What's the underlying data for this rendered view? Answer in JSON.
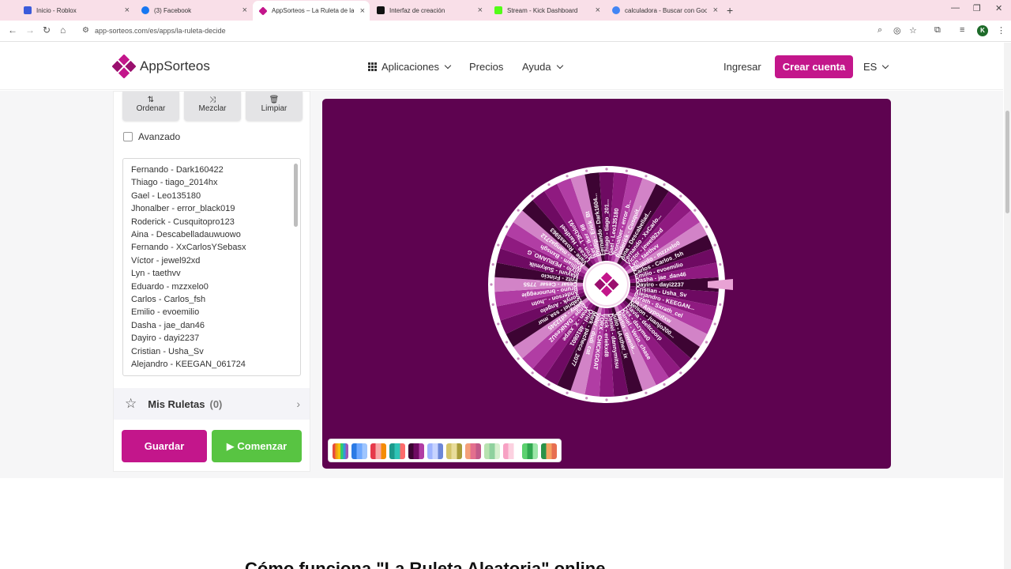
{
  "browser": {
    "tabs": [
      {
        "title": "Inicio - Roblox",
        "favicon_color": "#3b5bdb"
      },
      {
        "title": "(3) Facebook",
        "favicon_color": "#1877f2"
      },
      {
        "title": "AppSorteos – La Ruleta de la Su",
        "favicon_color": "#c3168b"
      },
      {
        "title": "Interfaz de creación",
        "favicon_color": "#111111"
      },
      {
        "title": "Stream - Kick Dashboard",
        "favicon_color": "#53fc18"
      },
      {
        "title": "calculadora - Buscar con Googl",
        "favicon_color": "#4285f4"
      }
    ],
    "url": "app-sorteos.com/es/apps/la-ruleta-decide",
    "profile_initial": "K"
  },
  "header": {
    "logo_text": "AppSorteos",
    "nav": [
      "Aplicaciones",
      "Precios",
      "Ayuda"
    ],
    "login": "Ingresar",
    "signup": "Crear cuenta",
    "language": "ES",
    "brand_color": "#c3168b"
  },
  "panel": {
    "tools": [
      "Ordenar",
      "Mezclar",
      "Limpiar"
    ],
    "advanced_label": "Avanzado",
    "names": [
      "Fernando - Dark160422",
      "Thiago - tiago_2014hx",
      "Gael - Leo135180",
      "Jhonalber - error_black019",
      "Roderick - Cusquitopro123",
      "Aina - Descabelladauwuowo",
      "Fernando - XxCarlosYSebasx",
      "Víctor - jewel92xd",
      "Lyn - taethvv",
      "Eduardo - mzzxelo0",
      "Carlos - Carlos_fsh",
      "Emilio - evoemilio",
      "Dasha - jae_dan46",
      "Dayiro  - dayi2237",
      "Cristian - Usha_Sv",
      "Alejandro - KEEGAN_061724"
    ],
    "mis_ruletas_label": "Mis Ruletas",
    "mis_ruletas_count": "(0)",
    "save_label": "Guardar",
    "start_label": "Comenzar"
  },
  "wheel": {
    "background": "#5e0350",
    "segment_colors": [
      "#3d0433",
      "#6e0a62",
      "#8f1a80",
      "#b13da4",
      "#d283c7"
    ],
    "labels": [
      "Dayiro - dayi2237",
      "Cristian - Usha_Sv",
      "Alejandro - KEEGAN...",
      "Sxrath - Sxrath_cel",
      "Lia - Anypoutxw",
      "Nelson - juanjo200...",
      "Flavia - deltcoorp",
      "Dex - dazyme0",
      "Daniel - Verin_chase",
      "Martin - owenk...",
      "Julio - iAsther_ix",
      "Daniel - dannymitsu",
      "Erick - eriekxd8",
      "YORX - CHICKGOAT",
      "Valer - dudi_cat",
      "Mark - pacheco_2077",
      "Oriel - 4810801",
      "Jean - X_xsrpe",
      "Ange - DANKesUZ",
      "Samy - xd12345",
      "Gabriel - ssa_mur",
      "Sonyk - Angelo",
      "Anderson - ..hotn",
      "Bruno - brunoreggie",
      "Cesar - Cesar_7755",
      "Fritz - Frincio",
      "Mayuni - Sukymilk",
      "Stylo - PERUANO_G",
      "William - Bxnsgh",
      "Angel - mangaz712",
      "Vane - Roxas5963",
      "Lucas - Hardfeel",
      "Aron - T3Kblo91",
      "Iker - Iker_98",
      "Phillip - Erick_Bt",
      "Fernando - Dark1604...",
      "Thiago - tiago_201...",
      "Gael - Leo135180",
      "Jhonalber - error_b...",
      "Roderick - Cusquit...",
      "Aina - Descabellad...",
      "Fernando - XxCarlo...",
      "Victor - jewel92xd",
      "Lyn - taethvv",
      "Eduardo - mzzxelo0",
      "Carlos - Carlos_fsh",
      "Emilio - evoemilio",
      "Dasha - jae_dan46"
    ]
  },
  "palettes": [
    {
      "colors": [
        "#e74c3c",
        "#f39c12",
        "#f1c40f",
        "#2ecc71",
        "#3498db",
        "#9b59b6"
      ]
    },
    {
      "colors": [
        "#2c7be5",
        "#6ea8fe",
        "#9ec5fe"
      ]
    },
    {
      "colors": [
        "#e6394a",
        "#f7a8a8",
        "#f48c06"
      ]
    },
    {
      "colors": [
        "#1b998b",
        "#2ec4b6",
        "#ff6b6b"
      ]
    },
    {
      "colors": [
        "#3d0433",
        "#6e0a62",
        "#b13da4"
      ]
    },
    {
      "colors": [
        "#9fb4ff",
        "#c7d3ff",
        "#6c87d8"
      ]
    },
    {
      "colors": [
        "#d4c46a",
        "#e8dc9a",
        "#a89c3a"
      ]
    },
    {
      "colors": [
        "#f4a07a",
        "#e36f8e",
        "#c25a8a"
      ]
    },
    {
      "colors": [
        "#b8e2b0",
        "#8fd19e",
        "#d7f0cf"
      ]
    },
    {
      "colors": [
        "#f7a1c4",
        "#fcd1e0",
        "#ffffff"
      ]
    },
    {
      "colors": [
        "#5bd16f",
        "#2fa84f",
        "#9ce6a8"
      ]
    },
    {
      "colors": [
        "#2b9348",
        "#f4a261",
        "#e76f51"
      ]
    }
  ],
  "footer": {
    "heading": "Cómo funciona \"La Ruleta Aleatoria\" online"
  }
}
